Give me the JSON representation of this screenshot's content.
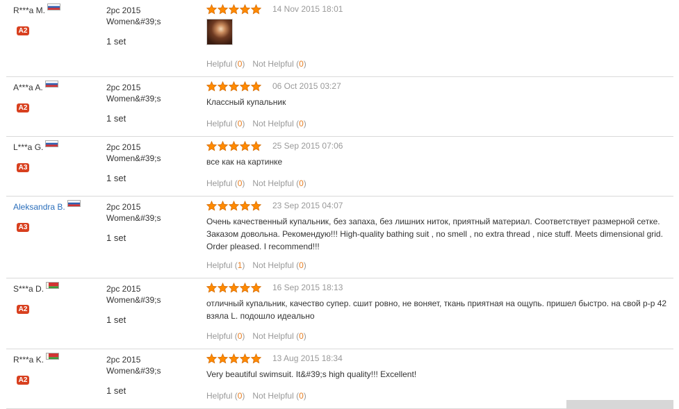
{
  "labels": {
    "helpful": "Helpful",
    "not_helpful": "Not Helpful"
  },
  "colors": {
    "star": "#ff8a00",
    "badge": "#d8401f",
    "count": "#e67e22",
    "link": "#2a6ebb"
  },
  "reviews": [
    {
      "user": "R***a M.",
      "flag": "russia",
      "level": "A2",
      "product": "2pc 2015",
      "product_line2": "Women&#39;s",
      "quantity": "1 set",
      "stars": 5,
      "date": "14 Nov 2015 18:01",
      "text": "",
      "has_photo": true,
      "helpful_count": "0",
      "not_helpful_count": "0"
    },
    {
      "user": "A***a A.",
      "flag": "russia",
      "level": "A2",
      "product": "2pc 2015",
      "product_line2": "Women&#39;s",
      "quantity": "1 set",
      "stars": 5,
      "date": "06 Oct 2015 03:27",
      "text": "Классный купальник",
      "has_photo": false,
      "helpful_count": "0",
      "not_helpful_count": "0"
    },
    {
      "user": "L***a G.",
      "flag": "russia",
      "level": "A3",
      "product": "2pc 2015",
      "product_line2": "Women&#39;s",
      "quantity": "1 set",
      "stars": 5,
      "date": "25 Sep 2015 07:06",
      "text": "все как на картинке",
      "has_photo": false,
      "helpful_count": "0",
      "not_helpful_count": "0"
    },
    {
      "user": "Aleksandra B.",
      "flag": "russia",
      "level": "A3",
      "product": "2pc 2015",
      "product_line2": "Women&#39;s",
      "quantity": "1 set",
      "stars": 5,
      "date": "23 Sep 2015 04:07",
      "text": "Очень качественный купальник, без запаха, без лишних ниток, приятный материал. Соответствует размерной сетке. Заказом довольна. Рекомендую!!! High-quality bathing suit , no smell , no extra thread , nice stuff. Meets dimensional grid. Order pleased. I recommend!!!",
      "has_photo": false,
      "helpful_count": "1",
      "not_helpful_count": "0",
      "user_link": true
    },
    {
      "user": "S***a D.",
      "flag": "belarus",
      "level": "A2",
      "product": "2pc 2015",
      "product_line2": "Women&#39;s",
      "quantity": "1 set",
      "stars": 5,
      "date": "16 Sep 2015 18:13",
      "text": "отличный купальник, качество супер. сшит ровно, не воняет, ткань приятная на ощупь. пришел быстро. на свой р-р 42 взяла L. подошло идеально",
      "has_photo": false,
      "helpful_count": "0",
      "not_helpful_count": "0"
    },
    {
      "user": "R***a K.",
      "flag": "belarus",
      "level": "A2",
      "product": "2pc 2015",
      "product_line2": "Women&#39;s",
      "quantity": "1 set",
      "stars": 5,
      "date": "13 Aug 2015 18:34",
      "text": "Very beautiful swimsuit. It&#39;s high quality!!! Excellent!",
      "has_photo": false,
      "helpful_count": "0",
      "not_helpful_count": "0"
    }
  ]
}
